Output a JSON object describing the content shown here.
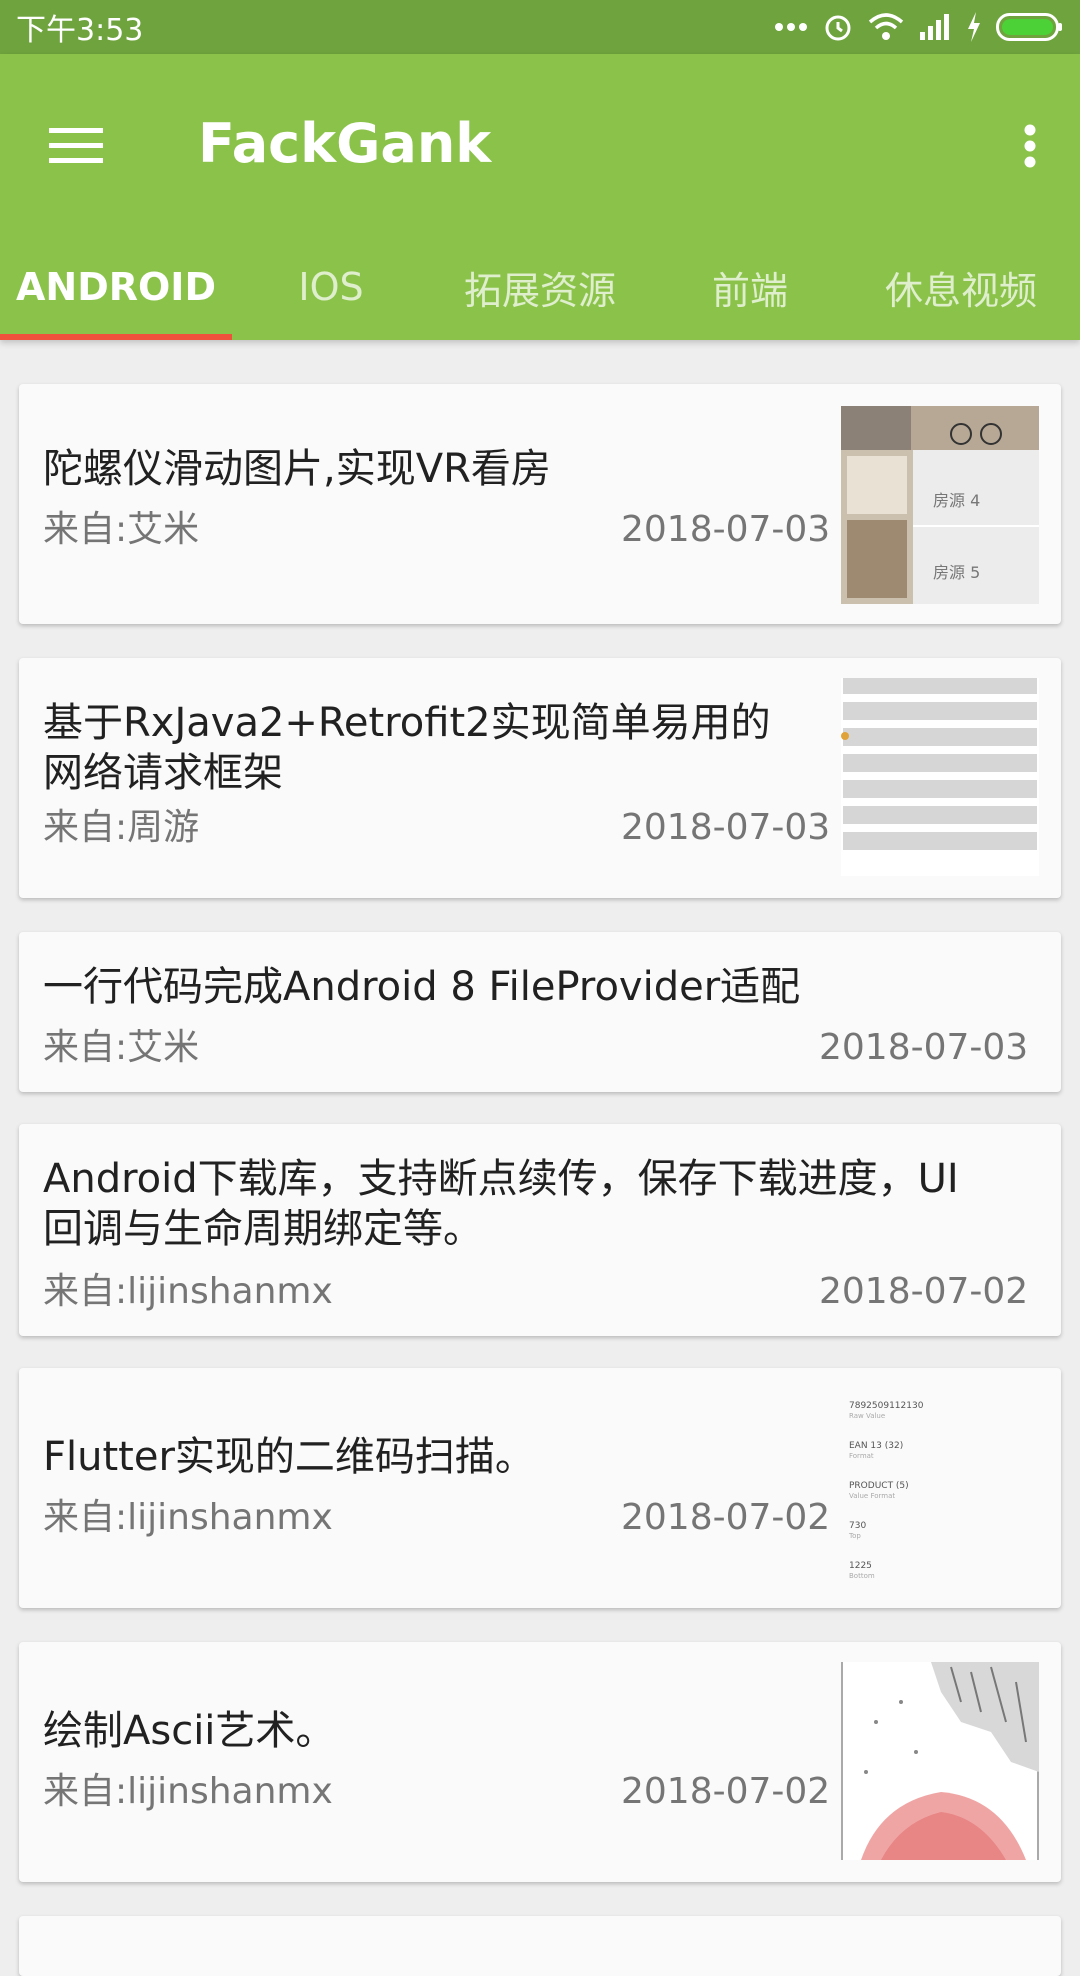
{
  "status": {
    "time": "下午3:53"
  },
  "app": {
    "title": "FackGank"
  },
  "tabs": [
    "ANDROID",
    "IOS",
    "拓展资源",
    "前端",
    "休息视频"
  ],
  "cards": [
    {
      "title_lines": [
        "陀螺仪滑动图片,实现VR看房"
      ],
      "source": "来自:艾米",
      "date": "2018-07-03",
      "thumb_labels": [
        "房源 4",
        "房源 5"
      ]
    },
    {
      "title_lines": [
        "基于RxJava2+Retrofit2实现简单易用的",
        "网络请求框架"
      ],
      "source": "来自:周游",
      "date": "2018-07-03"
    },
    {
      "title_lines": [
        "一行代码完成Android 8 FileProvider适配"
      ],
      "source": "来自:艾米",
      "date": "2018-07-03"
    },
    {
      "title_lines": [
        "Android下载库，支持断点续传，保存下载进度，UI",
        "回调与生命周期绑定等。"
      ],
      "source": "来自:lijinshanmx",
      "date": "2018-07-02"
    },
    {
      "title_lines": [
        "Flutter实现的二维码扫描。"
      ],
      "source": "来自:lijinshanmx",
      "date": "2018-07-02",
      "thumb_labels": [
        "7892509112130",
        "Raw Value",
        "EAN 13 (32)",
        "Format",
        "PRODUCT (5)",
        "Value Format",
        "730",
        "Top",
        "1225",
        "Bottom"
      ]
    },
    {
      "title_lines": [
        "绘制Ascii艺术。"
      ],
      "source": "来自:lijinshanmx",
      "date": "2018-07-02"
    }
  ]
}
